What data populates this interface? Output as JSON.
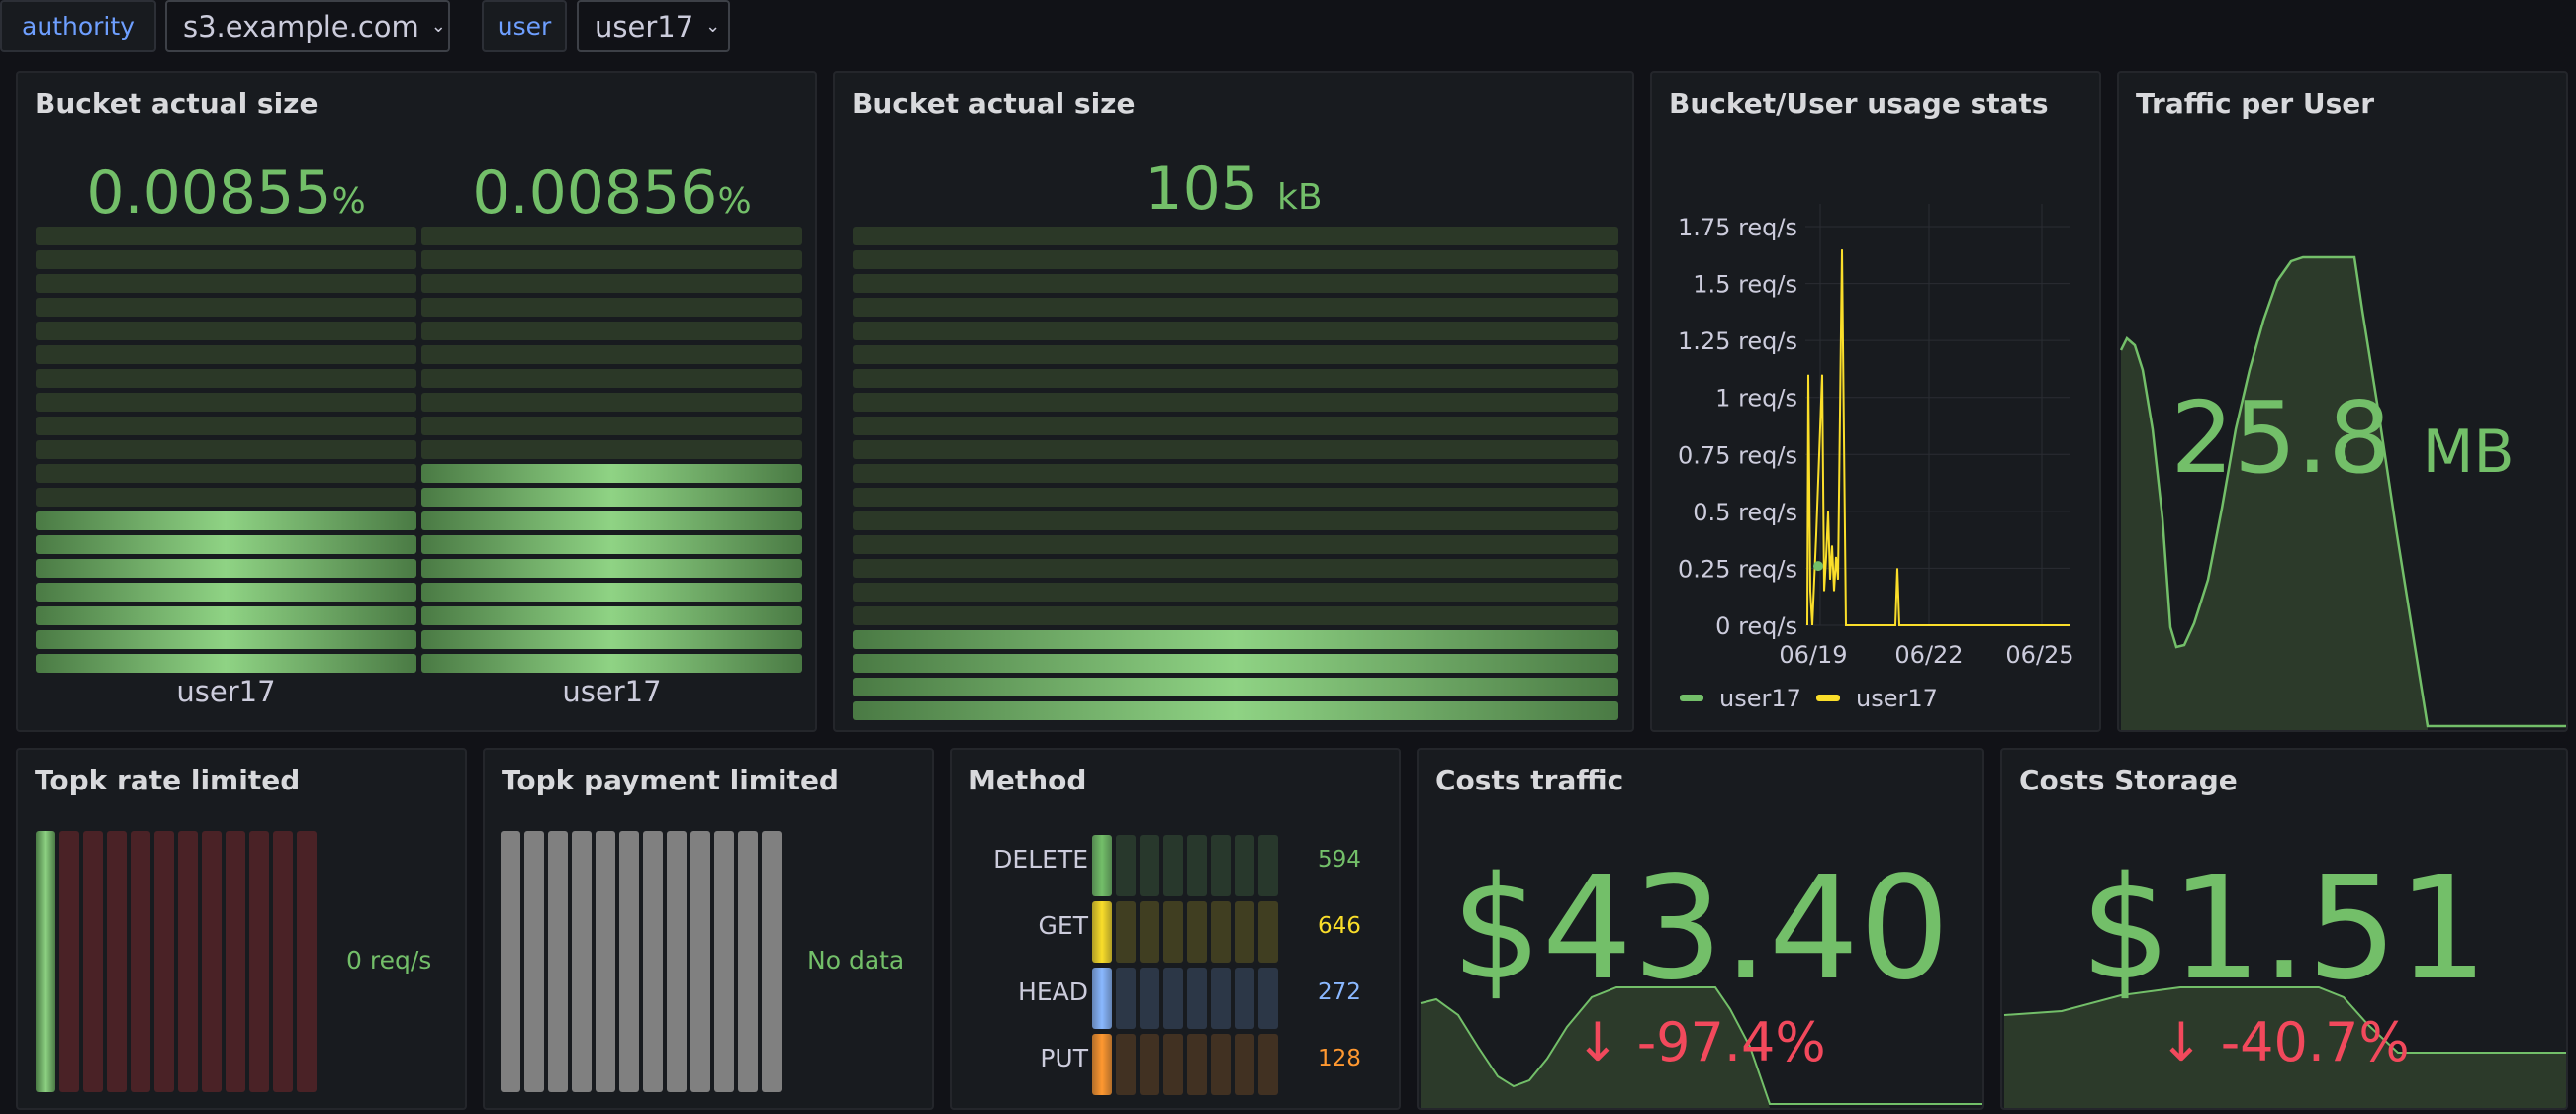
{
  "variables": [
    {
      "label": "authority",
      "value": "s3.example.com"
    },
    {
      "label": "user",
      "value": "user17"
    }
  ],
  "panels": {
    "bucket_size_pct": {
      "title": "Bucket actual size",
      "items": [
        {
          "value": "0.00855",
          "unit": "%",
          "name": "user17",
          "fill": 7
        },
        {
          "value": "0.00856",
          "unit": "%",
          "name": "user17",
          "fill": 9
        }
      ]
    },
    "bucket_size_abs": {
      "title": "Bucket actual size",
      "value": "105",
      "unit": "kB",
      "fill": 4
    },
    "usage_stats": {
      "title": "Bucket/User usage stats"
    },
    "traffic_user": {
      "title": "Traffic per User",
      "value": "25.8",
      "unit": "MB"
    },
    "topk_rate": {
      "title": "Topk rate limited",
      "value": "0 req/s",
      "fill_fraction": 0.0
    },
    "topk_payment": {
      "title": "Topk payment limited",
      "value": "No data"
    },
    "method": {
      "title": "Method",
      "rows": [
        {
          "label": "DELETE",
          "value": "594",
          "color": "#73bf69"
        },
        {
          "label": "GET",
          "value": "646",
          "color": "#fade2a"
        },
        {
          "label": "HEAD",
          "value": "272",
          "color": "#8ab8ff"
        },
        {
          "label": "PUT",
          "value": "128",
          "color": "#ff9830"
        }
      ]
    },
    "costs_traffic": {
      "title": "Costs traffic",
      "value": "$43.40",
      "change": "-97.4%"
    },
    "costs_storage": {
      "title": "Costs Storage",
      "value": "$1.51",
      "change": "-40.7%"
    }
  },
  "chart_data": {
    "type": "line",
    "title": "Bucket/User usage stats",
    "y_ticks": [
      "1.75 req/s",
      "1.5 req/s",
      "1.25 req/s",
      "1 req/s",
      "0.75 req/s",
      "0.5 req/s",
      "0.25 req/s",
      "0 req/s"
    ],
    "x_ticks": [
      "06/19",
      "06/22",
      "06/25"
    ],
    "ylim": [
      0,
      1.85
    ],
    "legend_position": "bottom",
    "series": [
      {
        "name": "user17",
        "color": "#73bf69",
        "x": [
          "06/19"
        ],
        "values": [
          0.26
        ]
      },
      {
        "name": "user17",
        "color": "#fade2a",
        "x": [
          "06/19",
          "06/19",
          "06/19",
          "06/19",
          "06/19",
          "06/20",
          "06/20",
          "06/20",
          "06/20",
          "06/20",
          "06/20",
          "06/20",
          "06/20",
          "06/20",
          "06/20",
          "06/20",
          "06/21",
          "06/22",
          "06/22",
          "06/22",
          "06/25"
        ],
        "values": [
          0,
          1.1,
          0.15,
          0,
          0.4,
          1.1,
          0.15,
          0.3,
          0.5,
          0.2,
          0.35,
          0.15,
          0.3,
          0.2,
          1.65,
          0,
          0,
          0,
          0.25,
          0,
          0
        ]
      }
    ]
  },
  "colors": {
    "accent": "#73bf69",
    "negative": "#f2495c",
    "background": "#111217",
    "panel": "#181b1f"
  }
}
